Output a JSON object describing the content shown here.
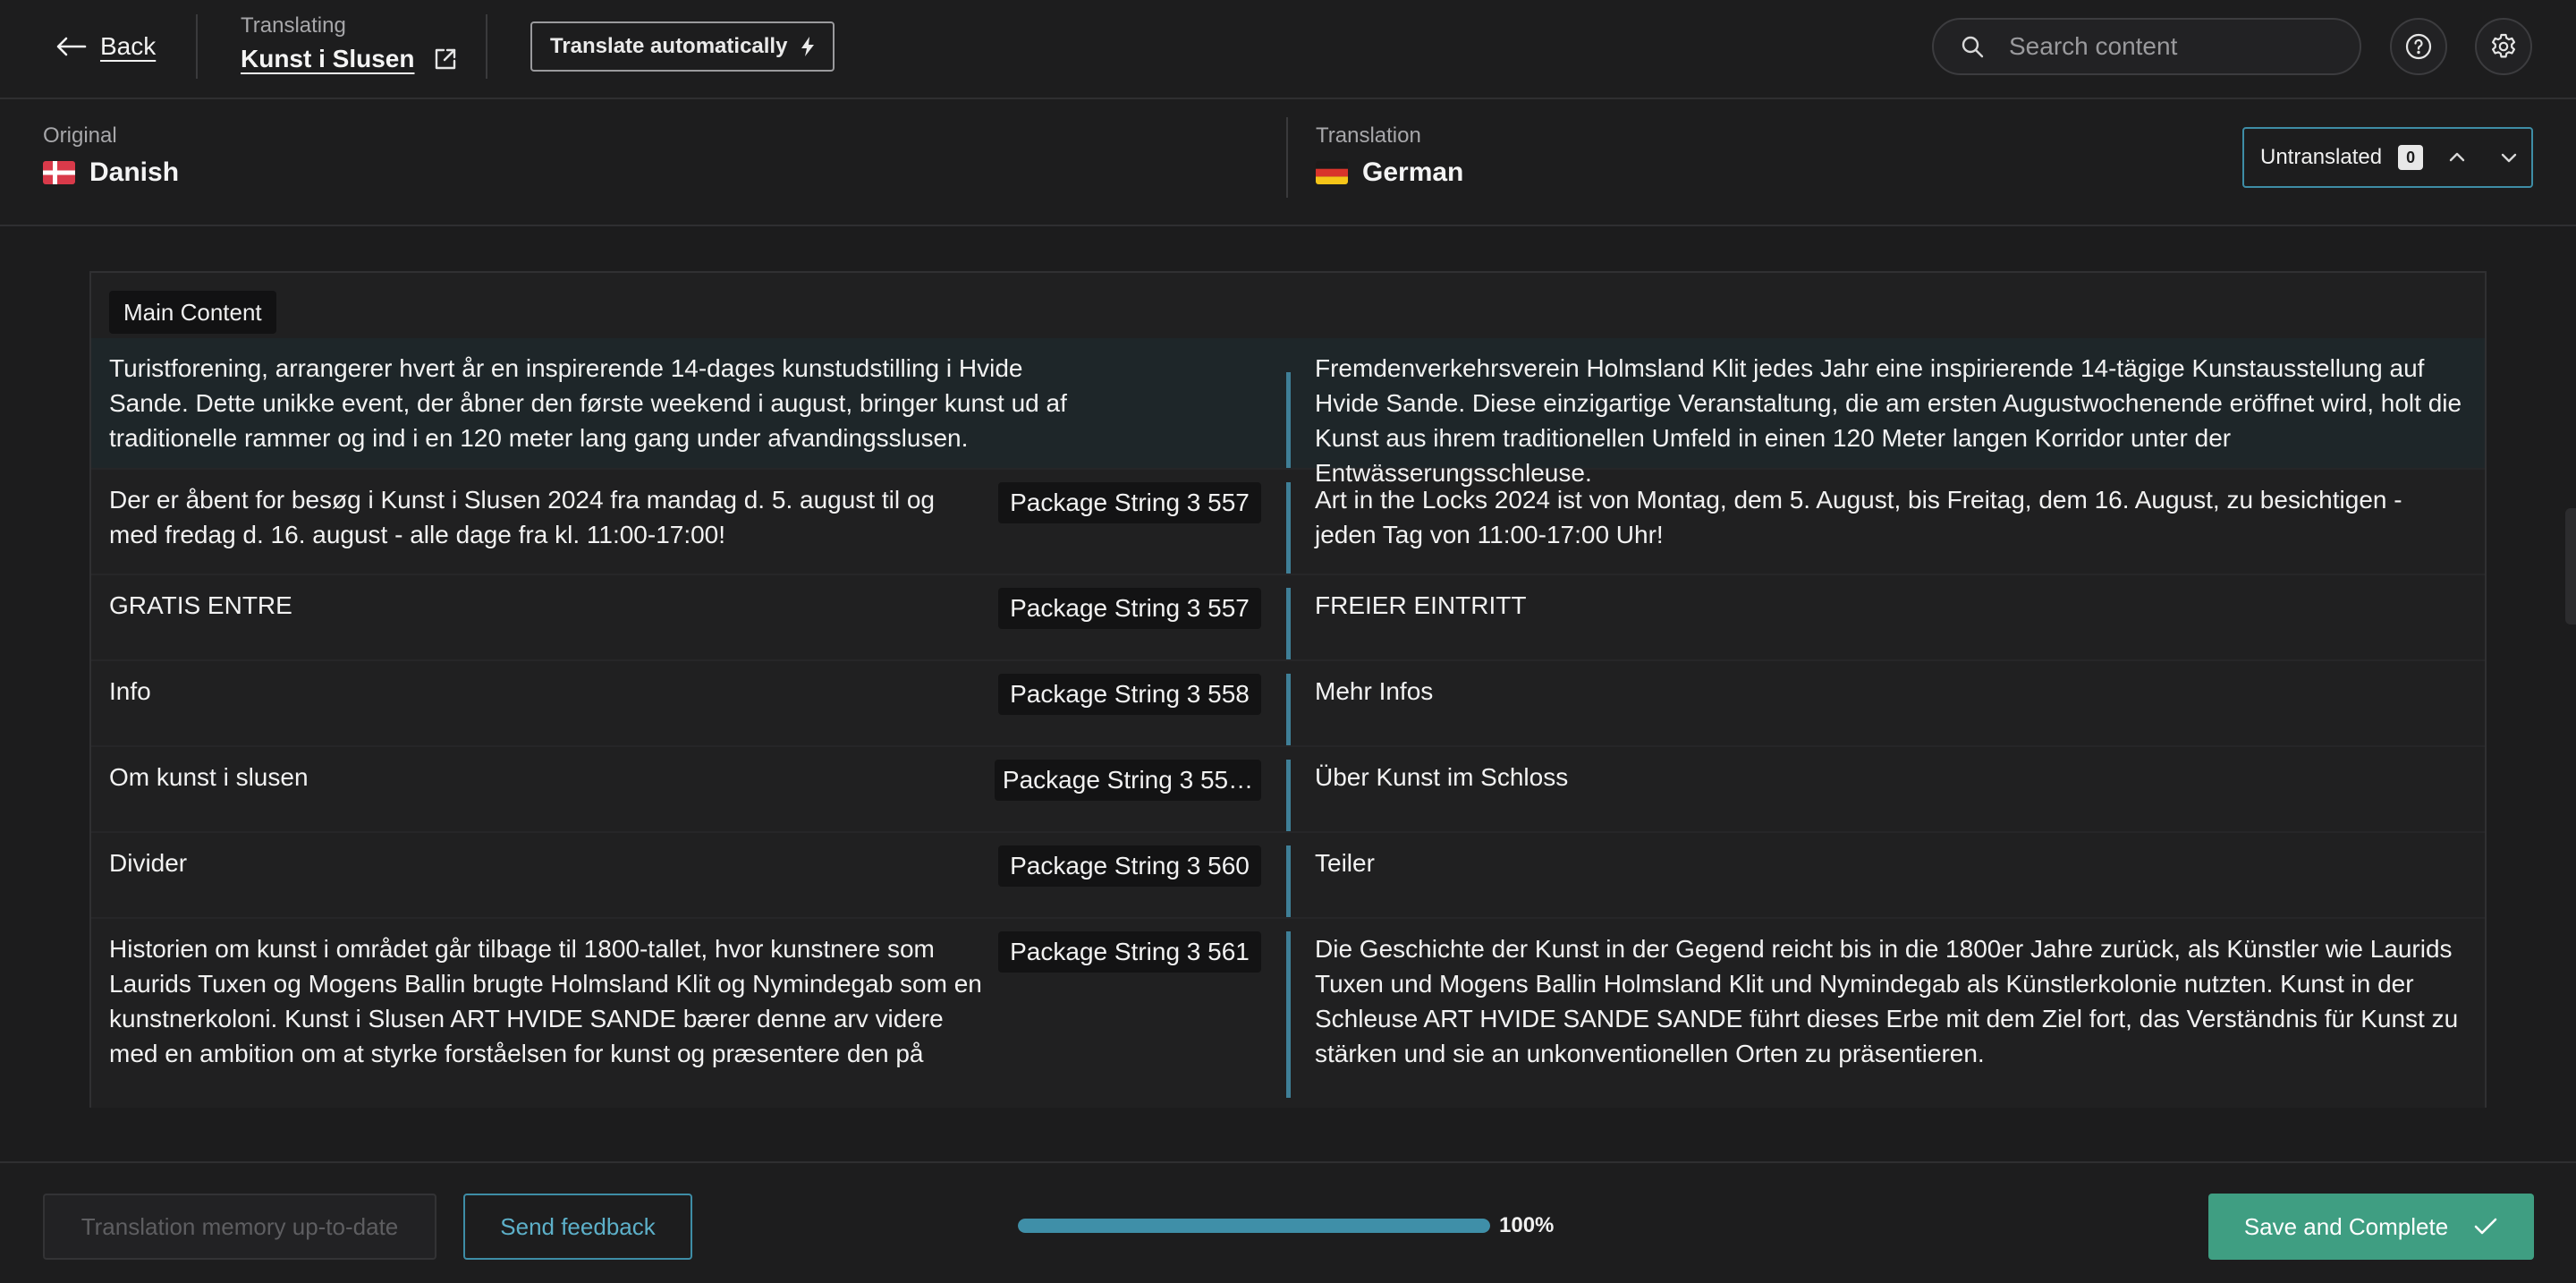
{
  "header": {
    "back_label": "Back",
    "translating_label": "Translating",
    "project_name": "Kunst i Slusen",
    "auto_translate_label": "Translate automatically",
    "search_placeholder": "Search content"
  },
  "languages": {
    "original_label": "Original",
    "original_name": "Danish",
    "translation_label": "Translation",
    "translation_name": "German",
    "filter_label": "Untranslated",
    "filter_count": "0"
  },
  "section": {
    "title": "Main Content"
  },
  "rows": [
    {
      "source": "Turistforening, arrangerer hvert år en inspirerende 14-dages kunstudstilling i Hvide Sande. Dette unikke event, der åbner den første weekend i august, bringer kunst ud af traditionelle rammer og ind i en 120 meter lang gang under afvandingsslusen.",
      "tag": "",
      "target": "Fremdenverkehrsverein Holmsland Klit jedes Jahr eine inspirierende 14-tägige Kunstausstellung auf Hvide Sande. Diese einzigartige Veranstaltung, die am ersten Augustwochenende eröffnet wird, holt die Kunst aus ihrem traditionellen Umfeld in einen 120 Meter langen Korridor unter der Entwässerungsschleuse."
    },
    {
      "source": "Der er åbent for besøg i Kunst i Slusen 2024 fra mandag d. 5. august til og med fredag d. 16. august - alle dage fra kl. 11:00-17:00!",
      "tag": "Package String 3 557",
      "target": "Art in the Locks 2024 ist von Montag, dem 5. August, bis Freitag, dem 16. August, zu besichtigen - jeden Tag von 11:00-17:00 Uhr!"
    },
    {
      "source": "GRATIS ENTRE",
      "tag": "Package String 3 557",
      "target": "FREIER EINTRITT"
    },
    {
      "source": "Info",
      "tag": "Package String 3 558",
      "target": "Mehr Infos"
    },
    {
      "source": "Om kunst i slusen",
      "tag": "Package String 3 55…",
      "target": "Über Kunst im Schloss"
    },
    {
      "source": "Divider",
      "tag": "Package String 3 560",
      "target": "Teiler"
    },
    {
      "source": "Historien om kunst i området går tilbage til 1800-tallet, hvor kunstnere som Laurids Tuxen og Mogens Ballin brugte Holmsland Klit og Nymindegab som en kunstnerkoloni. Kunst i Slusen ART HVIDE SANDE bærer denne arv videre med en ambition om at styrke forståelsen for kunst og præsentere den på",
      "tag": "Package String 3 561",
      "target": "Die Geschichte der Kunst in der Gegend reicht bis in die 1800er Jahre zurück, als Künstler wie Laurids Tuxen und Mogens Ballin Holmsland Klit und Nymindegab als Künstlerkolonie nutzten. Kunst in der Schleuse ART HVIDE SANDE SANDE führt dieses Erbe mit dem Ziel fort, das Verständnis für Kunst zu stärken und sie an unkonventionellen Orten zu präsentieren."
    }
  ],
  "footer": {
    "memory_label": "Translation memory up-to-date",
    "feedback_label": "Send feedback",
    "progress_value": 1.0,
    "progress_text": "100%",
    "save_label": "Save and Complete"
  },
  "icons": {
    "back": "arrow-left-icon",
    "external": "external-link-icon",
    "bolt": "lightning-icon",
    "search": "search-icon",
    "help": "question-icon",
    "settings": "gear-icon",
    "up": "chevron-up-icon",
    "down": "chevron-down-icon",
    "check": "check-icon"
  },
  "colors": {
    "accent": "#3e8da6",
    "primary": "#3f9e82",
    "background": "#1c1c1d"
  }
}
